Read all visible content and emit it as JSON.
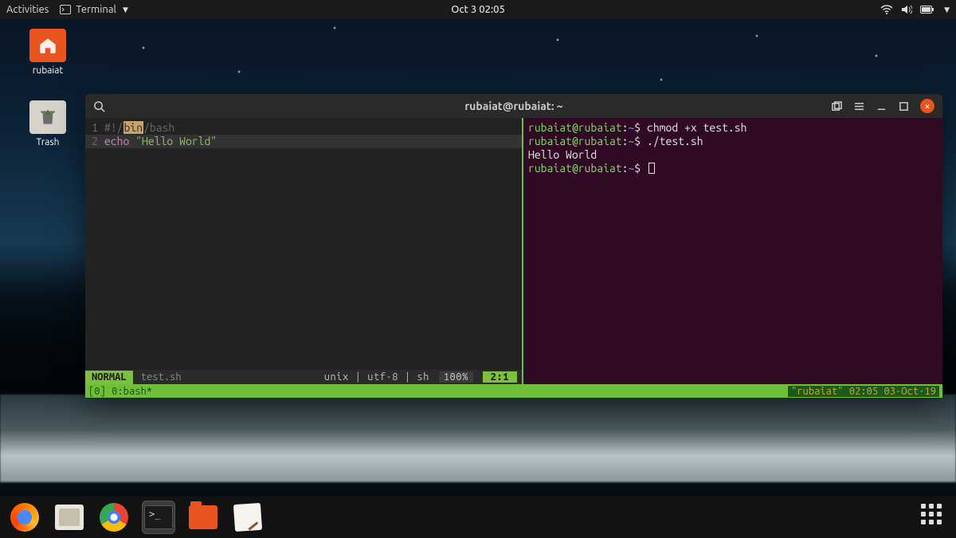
{
  "topbar": {
    "activities": "Activities",
    "app_name": "Terminal",
    "datetime": "Oct 3  02:05"
  },
  "desktop": {
    "home_label": "rubaiat",
    "trash_label": "Trash"
  },
  "window": {
    "title": "rubaiat@rubaiat: ~",
    "icons": {
      "search": "search-icon",
      "newtab": "new-tab-icon",
      "menu": "hamburger-menu-icon",
      "minimize": "minimize-icon",
      "maximize": "maximize-icon",
      "close": "close-icon"
    }
  },
  "editor": {
    "lines": [
      {
        "n": "1",
        "pre": "#!/",
        "hl": "bin",
        "post": "/bash"
      },
      {
        "n": "2",
        "kw": "echo",
        "str": "\"Hello World\""
      }
    ],
    "status": {
      "mode": "NORMAL",
      "file": "test.sh",
      "info": "unix | utf-8 | sh",
      "percent": "100%",
      "pos": "2:1"
    }
  },
  "shell": {
    "prompt_user": "rubaiat@rubaiat",
    "prompt_path": "~",
    "lines": [
      {
        "type": "cmd",
        "text": "chmod +x test.sh"
      },
      {
        "type": "cmd",
        "text": "./test.sh"
      },
      {
        "type": "out",
        "text": "Hello World"
      },
      {
        "type": "cmd",
        "text": ""
      }
    ]
  },
  "tmux": {
    "left": "[0] 0:bash*",
    "right": "\"rubaiat\" 02:05 03-Oct-19"
  },
  "dock": {
    "apps": [
      "firefox",
      "files",
      "chrome",
      "terminal",
      "nautilus-folder",
      "text-editor"
    ],
    "show_apps": "show-applications"
  }
}
